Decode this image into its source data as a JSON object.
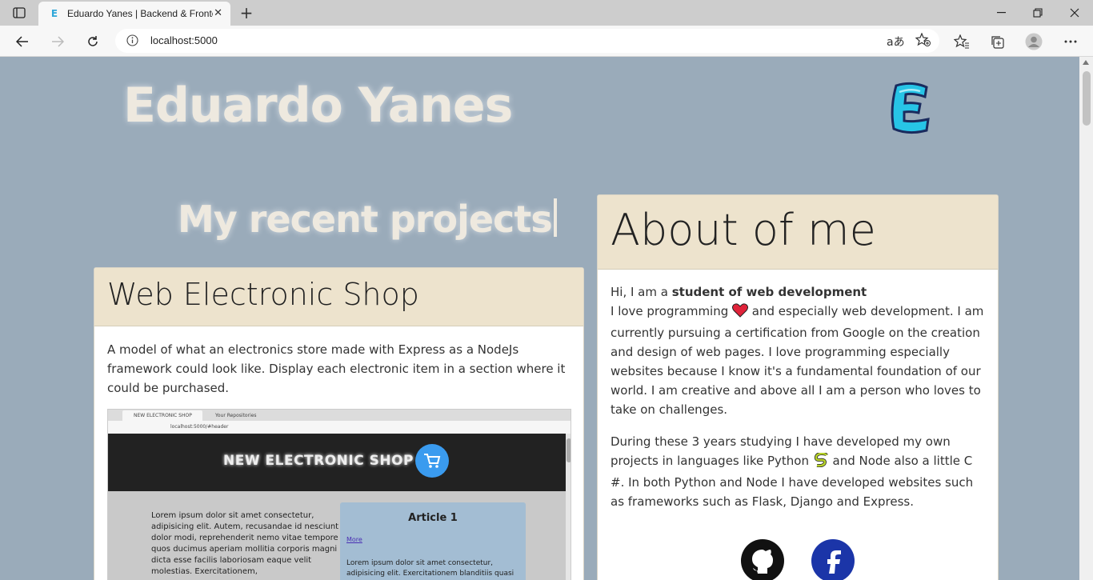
{
  "browser": {
    "tab_title": "Eduardo Yanes | Backend & Frontend",
    "tab_favicon": "E",
    "address": "localhost:5000",
    "icons": [
      "tab-actions-icon",
      "close-icon",
      "new-tab-icon",
      "minimize-icon",
      "restore-icon",
      "window-close-icon",
      "back-arrow-icon",
      "forward-arrow-icon",
      "refresh-icon",
      "site-info-icon",
      "read-aloud-icon",
      "add-favorite-icon",
      "favorites-icon",
      "collections-icon",
      "profile-avatar-icon",
      "more-menu-icon"
    ]
  },
  "site": {
    "title": "Eduardo Yanes",
    "logo_letter": "E",
    "projects_heading": "My recent projects"
  },
  "project": {
    "title": "Web Electronic Shop",
    "description": "A model of what an electronics store made with Express as a NodeJs framework could look like. Display each electronic item in a section where it could be purchased.",
    "screenshot": {
      "tab1": "NEW ELECTRONIC SHOP",
      "tab2": "Your Repositories",
      "address": "localhost:5000/#header",
      "hero": "NEW ELECTRONIC SHOP",
      "lorem": "Lorem ipsum dolor sit amet consectetur, adipisicing elit. Autem, recusandae id nesciunt dolor modi, reprehenderit nemo vitae tempore quos ducimus aperiam mollitia corporis magni dicta esse facilis laboriosam eaque velit molestias. Exercitationem,",
      "article_title": "Article 1",
      "article_more": "More",
      "article_text": "Lorem ipsum dolor sit amet consectetur, adipisicing elit. Exercitationem blanditiis quasi"
    }
  },
  "about": {
    "title": "About of me",
    "intro_prefix": "Hi, I am a ",
    "intro_bold": "student of web development",
    "p1_a": "I love programming ",
    "p1_b": " and especially web development. I am currently pursuing a certification from Google on the creation and design of web pages. I love programming especially websites because I know it's a fundamental foundation of our world. I am creative and above all I am a person who loves to take on challenges.",
    "p2_a": "During these 3 years studying I have developed my own projects in languages like Python ",
    "p2_b": " and Node also a little C #. In both Python and Node I have developed websites such as frameworks such as Flask, Django and Express.",
    "social": [
      "github-icon",
      "freecodecamp-icon"
    ]
  },
  "colors": {
    "page_bg": "#9aabba",
    "card_header": "#ede3cd",
    "title_text": "#eee9df"
  }
}
